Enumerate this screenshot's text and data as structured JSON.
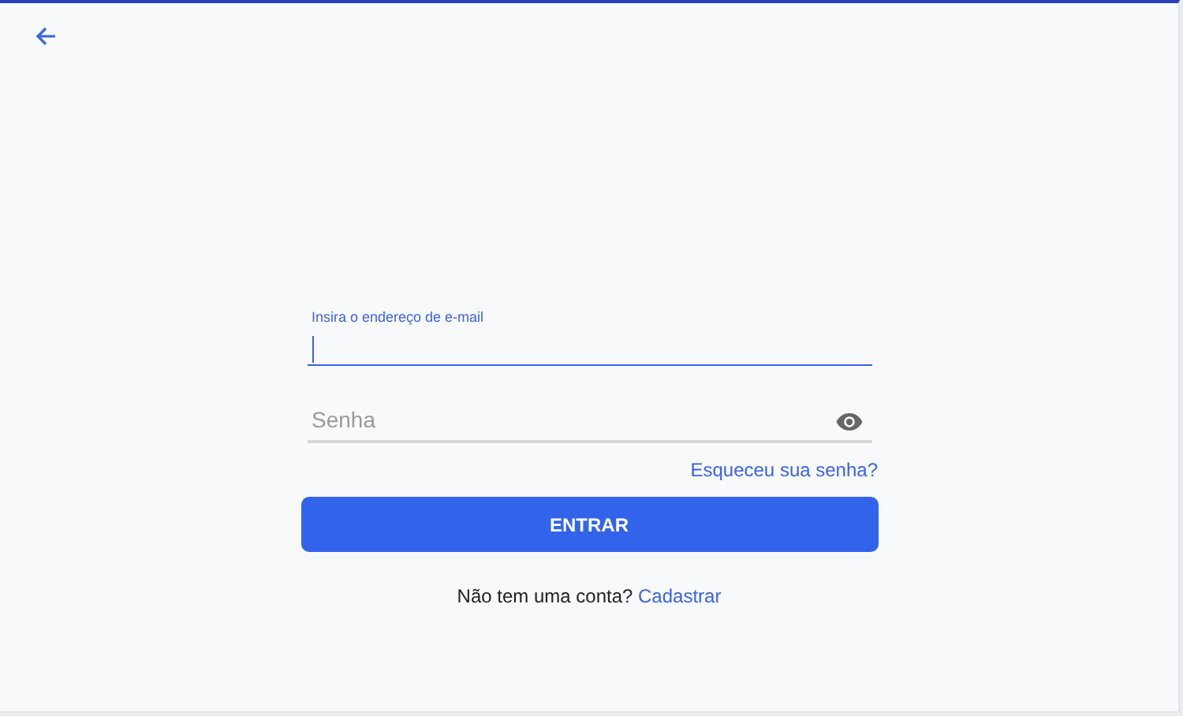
{
  "email_field": {
    "label": "Insira o endereço de e-mail",
    "focused": true
  },
  "password_field": {
    "placeholder": "Senha",
    "focused": false
  },
  "forgot_link": "Esqueceu sua senha?",
  "submit_button": "ENTRAR",
  "signup": {
    "prompt": "Não tem uma conta?",
    "link": "Cadastrar"
  }
}
